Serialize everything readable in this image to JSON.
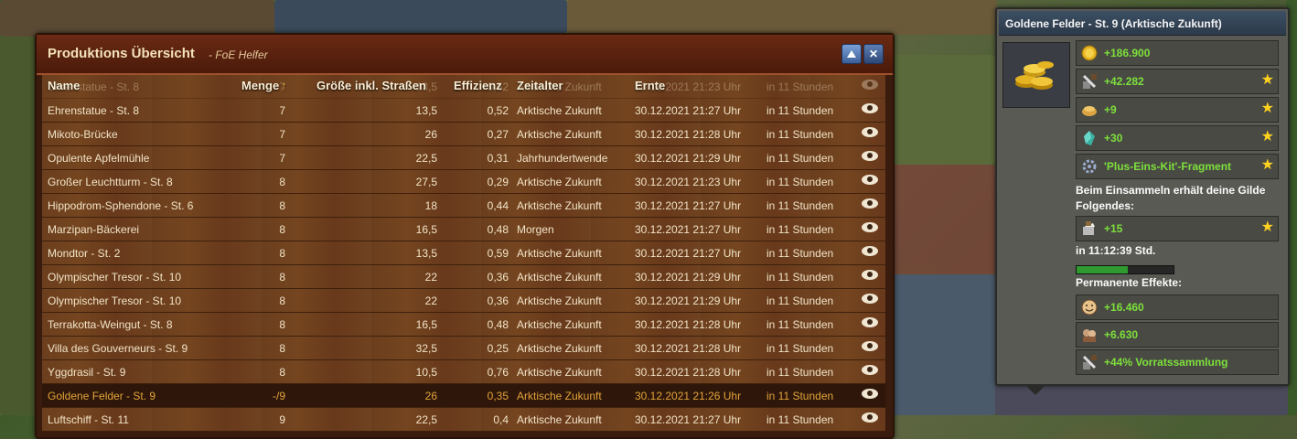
{
  "window": {
    "title": "Produktions Übersicht",
    "subtitle": "- FoE Helfer",
    "minimize_icon": "chevron-up-icon",
    "close_icon": "close-icon",
    "close_glyph": "✕"
  },
  "table": {
    "columns": {
      "name": "Name",
      "menge": "Menge",
      "groesse": "Größe inkl. Straßen",
      "effizienz": "Effizienz",
      "zeitalter": "Zeitalter",
      "ernte": "Ernte"
    },
    "sort_indicator": "↑",
    "ghost_row": {
      "name": "Ehrenstatue - St. 8",
      "menge": "7",
      "groesse": "13,5",
      "effizienz": "0,52",
      "zeitalter": "Arktische Zukunft",
      "ernte": "30.12.2021 21:23 Uhr",
      "in": "in 11 Stunden"
    },
    "rows": [
      {
        "name": "Ehrenstatue - St. 8",
        "menge": "7",
        "groesse": "13,5",
        "effizienz": "0,52",
        "zeitalter": "Arktische Zukunft",
        "ernte": "30.12.2021 21:27 Uhr",
        "in": "in 11 Stunden"
      },
      {
        "name": "Mikoto-Brücke",
        "menge": "7",
        "groesse": "26",
        "effizienz": "0,27",
        "zeitalter": "Arktische Zukunft",
        "ernte": "30.12.2021 21:28 Uhr",
        "in": "in 11 Stunden"
      },
      {
        "name": "Opulente Apfelmühle",
        "menge": "7",
        "groesse": "22,5",
        "effizienz": "0,31",
        "zeitalter": "Jahrhundertwende",
        "ernte": "30.12.2021 21:29 Uhr",
        "in": "in 11 Stunden"
      },
      {
        "name": "Großer Leuchtturm - St. 8",
        "menge": "8",
        "groesse": "27,5",
        "effizienz": "0,29",
        "zeitalter": "Arktische Zukunft",
        "ernte": "30.12.2021 21:23 Uhr",
        "in": "in 11 Stunden"
      },
      {
        "name": "Hippodrom-Sphendone - St. 6",
        "menge": "8",
        "groesse": "18",
        "effizienz": "0,44",
        "zeitalter": "Arktische Zukunft",
        "ernte": "30.12.2021 21:27 Uhr",
        "in": "in 11 Stunden"
      },
      {
        "name": "Marzipan-Bäckerei",
        "menge": "8",
        "groesse": "16,5",
        "effizienz": "0,48",
        "zeitalter": "Morgen",
        "ernte": "30.12.2021 21:27 Uhr",
        "in": "in 11 Stunden"
      },
      {
        "name": "Mondtor - St. 2",
        "menge": "8",
        "groesse": "13,5",
        "effizienz": "0,59",
        "zeitalter": "Arktische Zukunft",
        "ernte": "30.12.2021 21:27 Uhr",
        "in": "in 11 Stunden"
      },
      {
        "name": "Olympischer Tresor - St. 10",
        "menge": "8",
        "groesse": "22",
        "effizienz": "0,36",
        "zeitalter": "Arktische Zukunft",
        "ernte": "30.12.2021 21:29 Uhr",
        "in": "in 11 Stunden"
      },
      {
        "name": "Olympischer Tresor - St. 10",
        "menge": "8",
        "groesse": "22",
        "effizienz": "0,36",
        "zeitalter": "Arktische Zukunft",
        "ernte": "30.12.2021 21:29 Uhr",
        "in": "in 11 Stunden"
      },
      {
        "name": "Terrakotta-Weingut - St. 8",
        "menge": "8",
        "groesse": "16,5",
        "effizienz": "0,48",
        "zeitalter": "Arktische Zukunft",
        "ernte": "30.12.2021 21:28 Uhr",
        "in": "in 11 Stunden"
      },
      {
        "name": "Villa des Gouverneurs - St. 9",
        "menge": "8",
        "groesse": "32,5",
        "effizienz": "0,25",
        "zeitalter": "Arktische Zukunft",
        "ernte": "30.12.2021 21:28 Uhr",
        "in": "in 11 Stunden"
      },
      {
        "name": "Yggdrasil - St. 9",
        "menge": "8",
        "groesse": "10,5",
        "effizienz": "0,76",
        "zeitalter": "Arktische Zukunft",
        "ernte": "30.12.2021 21:28 Uhr",
        "in": "in 11 Stunden"
      },
      {
        "name": "Goldene Felder - St. 9",
        "menge": "-/9",
        "groesse": "26",
        "effizienz": "0,35",
        "zeitalter": "Arktische Zukunft",
        "ernte": "30.12.2021 21:26 Uhr",
        "in": "in 11 Stunden",
        "selected": true
      },
      {
        "name": "Luftschiff - St. 11",
        "menge": "9",
        "groesse": "22,5",
        "effizienz": "0,4",
        "zeitalter": "Arktische Zukunft",
        "ernte": "30.12.2021 21:27 Uhr",
        "in": "in 11 Stunden"
      }
    ]
  },
  "tooltip": {
    "title": "Goldene Felder - St. 9 (Arktische Zukunft)",
    "main_icon": "coins-icon",
    "items": [
      {
        "icon": "coin-icon",
        "value": "+186.900",
        "star": false
      },
      {
        "icon": "supplies-icon",
        "value": "+42.282",
        "star": true
      },
      {
        "icon": "goods-icon",
        "value": "+9",
        "star": true
      },
      {
        "icon": "crystal-icon",
        "value": "+30",
        "star": true
      },
      {
        "icon": "gear-icon",
        "value": "'Plus-Eins-Kit'-Fragment",
        "star": true
      }
    ],
    "guild_text": "Beim Einsammeln erhält deine Gilde Folgendes:",
    "guild_item": {
      "icon": "guild-goods-icon",
      "value": "+15",
      "star": true
    },
    "timer_text": "in 11:12:39 Std.",
    "timer_progress": 0.53,
    "permanent_label": "Permanente Effekte:",
    "permanent_items": [
      {
        "icon": "happiness-icon",
        "value": "+16.460"
      },
      {
        "icon": "population-icon",
        "value": "+6.630"
      },
      {
        "icon": "supply-boost-icon",
        "value": "+44% Vorratssammlung"
      }
    ],
    "star_glyph": "★"
  },
  "colors": {
    "accent_green": "#7ce03a",
    "selected_row_text": "#e3a33a",
    "star": "#ffd21f"
  }
}
